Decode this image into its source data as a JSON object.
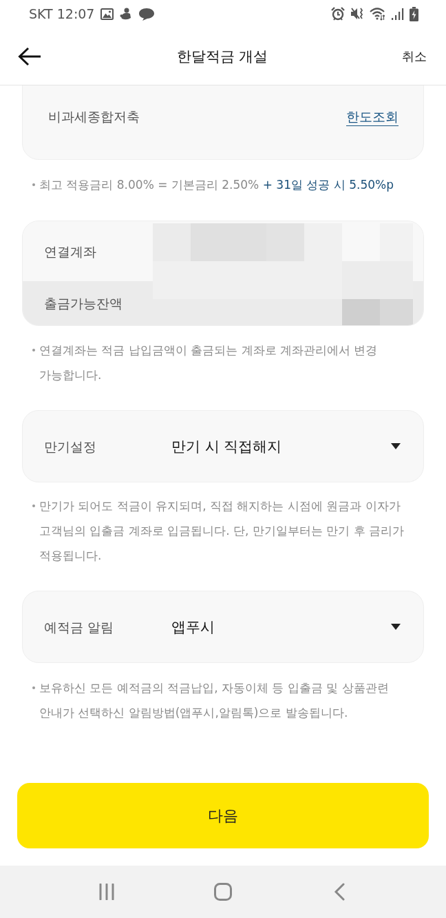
{
  "status_bar": {
    "carrier": "SKT",
    "time": "12:07"
  },
  "header": {
    "title": "한달적금 개설",
    "cancel": "취소"
  },
  "tax_card": {
    "label": "비과세종합저축",
    "link": "한도조회"
  },
  "rate_note": {
    "text": "최고 적용금리 8.00% = 기본금리 2.50%",
    "highlight": "+ 31일 성공 시 5.50%p"
  },
  "account_card": {
    "account_label": "연결계좌",
    "balance_label": "출금가능잔액"
  },
  "account_note": "연결계좌는 적금 납입금액이 출금되는 계좌로 계좌관리에서 변경 가능합니다.",
  "maturity_select": {
    "label": "만기설정",
    "value": "만기 시 직접해지"
  },
  "maturity_note": "만기가 되어도 적금이 유지되며, 직접 해지하는 시점에 원금과 이자가 고객님의 입출금 계좌로 입금됩니다. 단, 만기일부터는 만기 후 금리가 적용됩니다.",
  "alert_select": {
    "label": "예적금 알림",
    "value": "앱푸시"
  },
  "alert_note": "보유하신 모든 예적금의 적금납입, 자동이체 등 입출금 및 상품관련 안내가 선택하신 알림방법(앱푸시,알림톡)으로 발송됩니다.",
  "next_button": "다음"
}
